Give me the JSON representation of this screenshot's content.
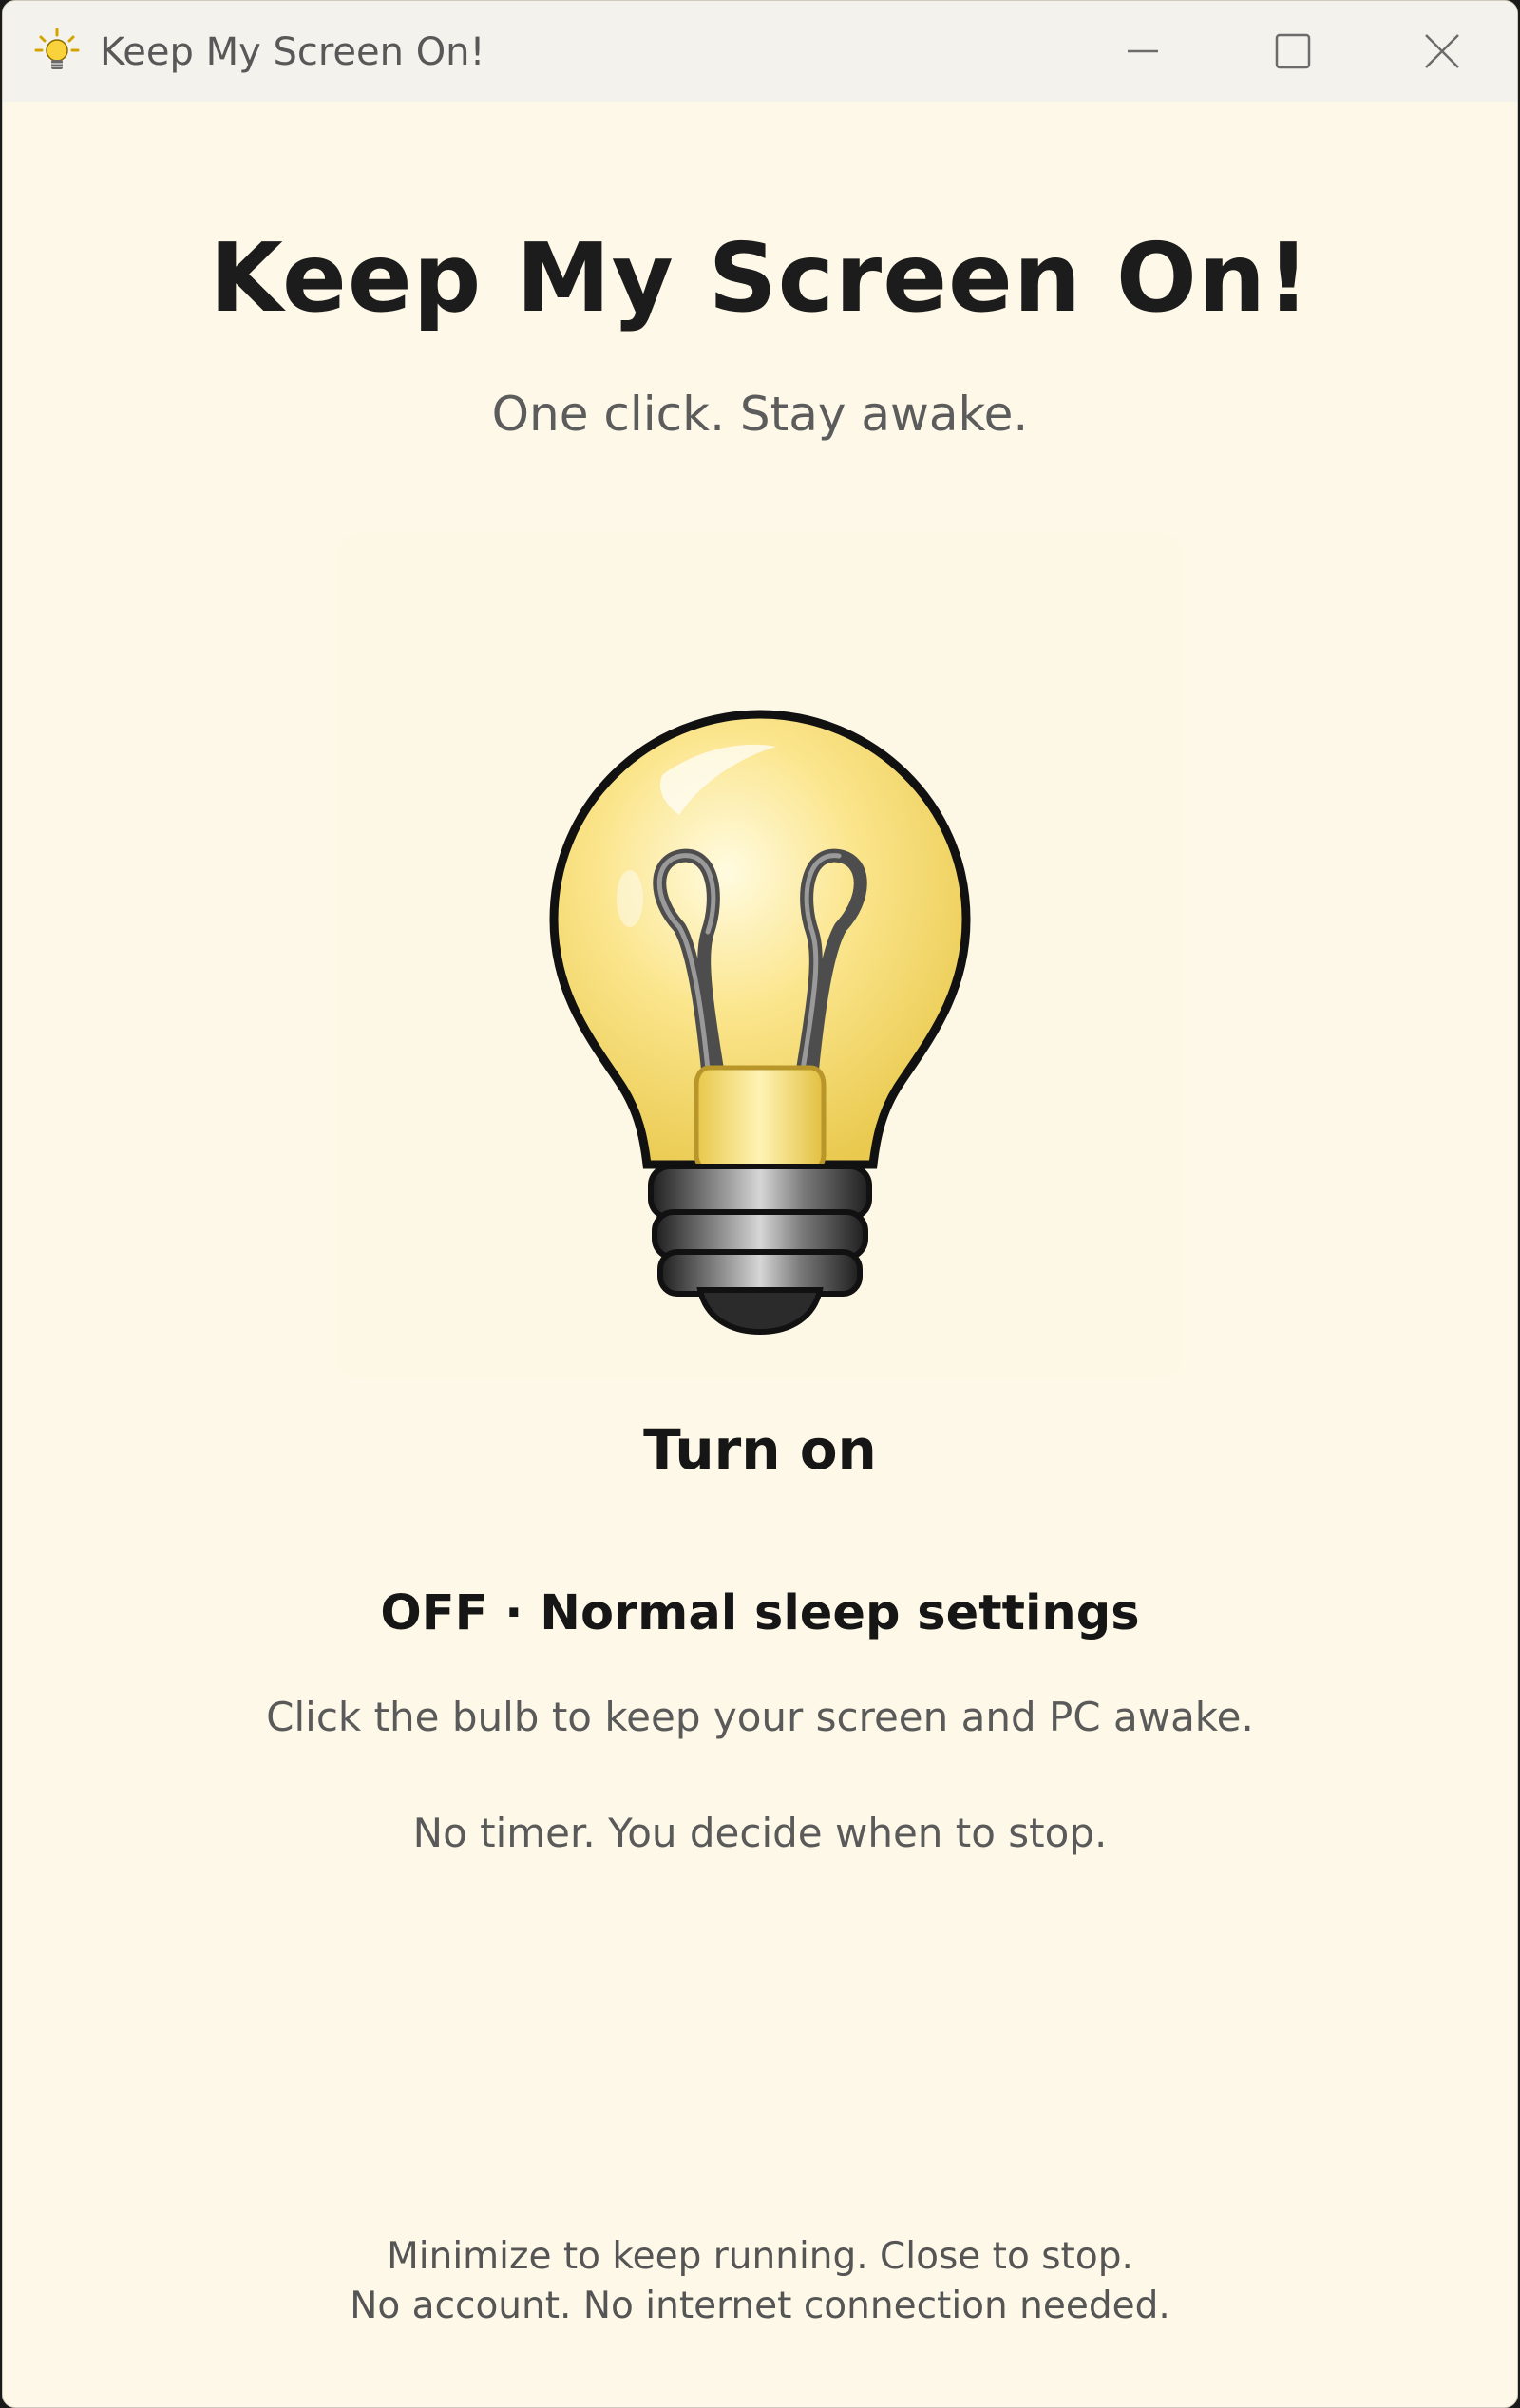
{
  "window": {
    "title": "Keep My Screen On!",
    "icon": "lightbulb-icon",
    "controls": {
      "minimize": "minimize-icon",
      "maximize": "maximize-icon",
      "close": "close-icon"
    }
  },
  "main": {
    "heading": "Keep My Screen On!",
    "tagline": "One click. Stay awake.",
    "bulb_icon": "lightbulb-icon",
    "action_label": "Turn on",
    "status": "OFF · Normal sleep settings",
    "description": [
      "Click the bulb to keep your screen and PC awake.",
      "No timer. You decide when to stop."
    ]
  },
  "footer": {
    "lines": [
      "Minimize to keep running. Close to stop.",
      "No account. No internet connection needed."
    ]
  },
  "colors": {
    "background": "#fdf8e7",
    "titlebar": "#f4f2ec",
    "bulb_glass": "#f7dd6e",
    "text_primary": "#161616",
    "text_secondary": "#5a5a5a"
  }
}
